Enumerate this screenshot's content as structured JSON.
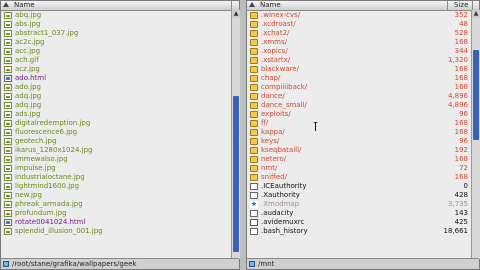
{
  "left_pane": {
    "header": {
      "name_label": "Name"
    },
    "path": "/root/stane/grafika/wallpapers/geek",
    "files": [
      {
        "name": "abq.jpg",
        "kind": "img",
        "color": "green"
      },
      {
        "name": "abs.jpg",
        "kind": "img",
        "color": "green"
      },
      {
        "name": "abstract1_037.jpg",
        "kind": "img",
        "color": "green"
      },
      {
        "name": "ac2c.jpg",
        "kind": "img",
        "color": "green"
      },
      {
        "name": "acc.jpg",
        "kind": "img",
        "color": "green"
      },
      {
        "name": "ach.gif",
        "kind": "img",
        "color": "green"
      },
      {
        "name": "acz.jpg",
        "kind": "img",
        "color": "green"
      },
      {
        "name": "ado.html",
        "kind": "html",
        "color": "html"
      },
      {
        "name": "ado.jpg",
        "kind": "img",
        "color": "green"
      },
      {
        "name": "adq.jpg",
        "kind": "img",
        "color": "green"
      },
      {
        "name": "adq.jpg",
        "kind": "img",
        "color": "green"
      },
      {
        "name": "ads.jpg",
        "kind": "img",
        "color": "green"
      },
      {
        "name": "digitalredemption.jpg",
        "kind": "img",
        "color": "green"
      },
      {
        "name": "fluorescence6.jpg",
        "kind": "img",
        "color": "green"
      },
      {
        "name": "geotech.jpg",
        "kind": "img",
        "color": "green"
      },
      {
        "name": "ikarus_1280x1024.jpg",
        "kind": "img",
        "color": "green"
      },
      {
        "name": "immewalso.jpg",
        "kind": "img",
        "color": "green"
      },
      {
        "name": "impulse.jpg",
        "kind": "img",
        "color": "green"
      },
      {
        "name": "industrialoctane.jpg",
        "kind": "img",
        "color": "green"
      },
      {
        "name": "lightmind1600.jpg",
        "kind": "img",
        "color": "green"
      },
      {
        "name": "new.jpg",
        "kind": "img",
        "color": "green"
      },
      {
        "name": "phreak_armada.jpg",
        "kind": "img",
        "color": "green"
      },
      {
        "name": "profundum.jpg",
        "kind": "img",
        "color": "green"
      },
      {
        "name": "rotate0041024.html",
        "kind": "html",
        "color": "html"
      },
      {
        "name": "splendid_illusion_001.jpg",
        "kind": "img",
        "color": "green"
      }
    ]
  },
  "right_pane": {
    "header": {
      "name_label": "Name",
      "size_label": "Size"
    },
    "path": "/mnt",
    "files": [
      {
        "name": ".winex-cvs/",
        "size": "352",
        "kind": "dir",
        "color": "red"
      },
      {
        "name": ".xcdroast/",
        "size": "48",
        "kind": "dir",
        "color": "red"
      },
      {
        "name": ".xchat2/",
        "size": "528",
        "kind": "dir",
        "color": "red"
      },
      {
        "name": ".xmms/",
        "size": "168",
        "kind": "dir",
        "color": "red"
      },
      {
        "name": ".xopics/",
        "size": "344",
        "kind": "dir",
        "color": "red"
      },
      {
        "name": ".xstartx/",
        "size": "1,320",
        "kind": "dir",
        "color": "red"
      },
      {
        "name": "blackware/",
        "size": "168",
        "kind": "dir",
        "color": "red"
      },
      {
        "name": "chap/",
        "size": "168",
        "kind": "dir",
        "color": "red"
      },
      {
        "name": "compiiiiback/",
        "size": "168",
        "kind": "dir",
        "color": "red"
      },
      {
        "name": "dance/",
        "size": "4,896",
        "kind": "dir",
        "color": "red"
      },
      {
        "name": "dance_small/",
        "size": "4,896",
        "kind": "dir",
        "color": "red"
      },
      {
        "name": "exploits/",
        "size": "96",
        "kind": "dir",
        "color": "red"
      },
      {
        "name": "ff/",
        "size": "168",
        "kind": "dir",
        "color": "red"
      },
      {
        "name": "kappa/",
        "size": "168",
        "kind": "dir",
        "color": "red"
      },
      {
        "name": "keys/",
        "size": "96",
        "kind": "dir",
        "color": "red"
      },
      {
        "name": "kseqbataill/",
        "size": "192",
        "kind": "dir",
        "color": "red"
      },
      {
        "name": "netero/",
        "size": "168",
        "kind": "dir",
        "color": "red"
      },
      {
        "name": "nmt/",
        "size": "72",
        "kind": "dir",
        "color": "red"
      },
      {
        "name": "sniffed/",
        "size": "168",
        "kind": "dir",
        "color": "red"
      },
      {
        "name": ".ICEauthority",
        "size": "0",
        "kind": "doc",
        "color": "black"
      },
      {
        "name": ".Xauthority",
        "size": "428",
        "kind": "doc",
        "color": "black"
      },
      {
        "name": ".Xmodmap",
        "size": "3,735",
        "kind": "link",
        "color": "gray"
      },
      {
        "name": ".audacity",
        "size": "143",
        "kind": "doc",
        "color": "black"
      },
      {
        "name": ".avidemuxrc",
        "size": "425",
        "kind": "file",
        "color": "black"
      },
      {
        "name": ".bash_history",
        "size": "18,661",
        "kind": "doc",
        "color": "black"
      }
    ]
  },
  "colors": {
    "selection_thumb": "#3a63b6",
    "image_file": "#6a8a1c",
    "html_file": "#7a1a86",
    "directory": "#d0482f"
  }
}
